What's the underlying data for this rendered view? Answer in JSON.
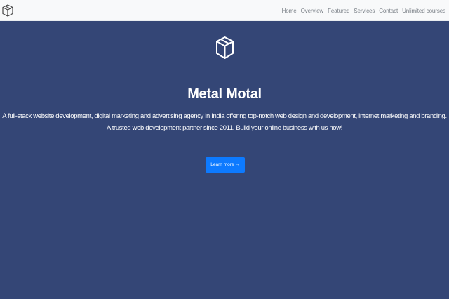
{
  "nav": {
    "brand_icon": "box-icon",
    "links": [
      "Home",
      "Overview",
      "Featured",
      "Services",
      "Contact",
      "Unlimited courses"
    ]
  },
  "hero": {
    "icon": "box-icon",
    "title": "Metal Motal",
    "line1": "A full-stack website development, digital marketing and advertising agency in India offering top-notch web design and development, internet marketing and branding.",
    "line2": "A trusted web development partner since 2011. Build your online business with us now!",
    "cta_label": "Learn more →"
  },
  "colors": {
    "navbar_bg": "#f8f9fa",
    "hero_bg": "#344676",
    "cta_bg": "#0d7aff",
    "nav_link": "#7b8188"
  }
}
